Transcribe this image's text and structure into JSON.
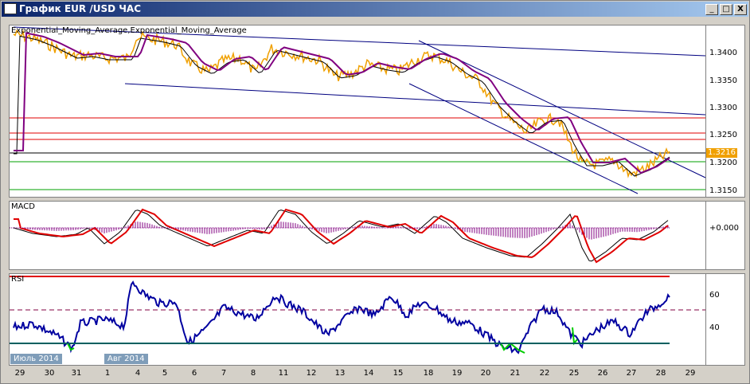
{
  "window": {
    "title": "График EUR /USD ЧАС",
    "minimize_label": "_",
    "maximize_label": "□",
    "close_label": "X"
  },
  "price_panel": {
    "indicator_label": "Exponential_Moving_Average,Exponential_Moving_Average",
    "y_ticks": [
      "1.3400",
      "1.3350",
      "1.3300",
      "1.3250",
      "1.3200",
      "1.3150"
    ],
    "current_price": "1.3216",
    "price_color": "#f0a000",
    "ema_fast_color": "#000000",
    "ema_slow_color": "#800080"
  },
  "macd_panel": {
    "label": "MACD",
    "y_ticks": [
      "+0.000"
    ],
    "signal_color": "#e00000"
  },
  "rsi_panel": {
    "label": "RSI",
    "y_ticks": [
      "60",
      "40"
    ],
    "line_color": "#0000a0",
    "oversold_color": "#00cc00"
  },
  "time_axis": {
    "labels": [
      "29",
      "30",
      "31",
      "1",
      "4",
      "5",
      "6",
      "7",
      "8",
      "11",
      "12",
      "13",
      "14",
      "15",
      "18",
      "19",
      "20",
      "21",
      "22",
      "25",
      "26",
      "27",
      "28",
      "29"
    ],
    "month_markers": [
      "Июль 2014",
      "Авг 2014"
    ]
  }
}
